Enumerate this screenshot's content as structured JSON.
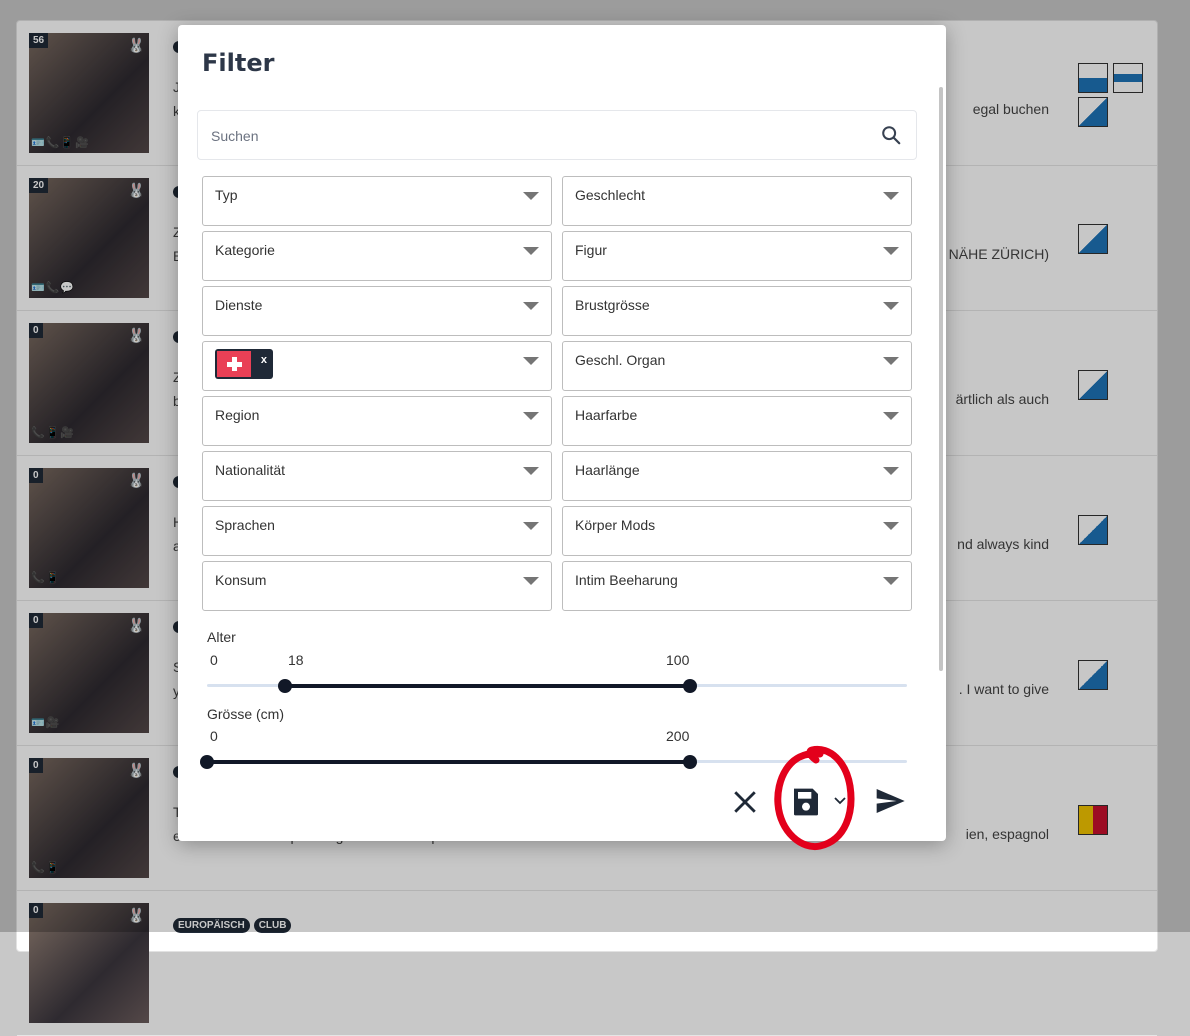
{
  "background": {
    "rows": [
      {
        "count": "56",
        "line1": "J",
        "line2": "k",
        "right1": "egal buchen",
        "bunny_color": "#e94056",
        "icons": "🪪📞📱🎥"
      },
      {
        "count": "20",
        "line1": "Z",
        "line2": "B",
        "right1": "NÄHE ZÜRICH)",
        "bunny_color": "#f2c500",
        "icons": "🪪📞💬"
      },
      {
        "count": "0",
        "line1": "Z",
        "line2": "b",
        "right1": "ärtlich als auch",
        "bunny_color": "#e5e5e5",
        "icons": "📞📱🎥"
      },
      {
        "count": "0",
        "line1": "H",
        "line2": "a",
        "right1": "nd always kind",
        "bunny_color": "#e5e5e5",
        "icons": "📞📱"
      },
      {
        "count": "0",
        "line1": "S",
        "line2": "y",
        "right1": ". I want to give",
        "bunny_color": "#e5e5e5",
        "icons": "🪪🎥"
      },
      {
        "count": "0",
        "line1": "T",
        "line2": "et Allemand. Se déplace également. Mes photos sont bien rée...",
        "right1": "ien, espagnol",
        "bunny_color": "#e5e5e5",
        "icons": "📞📱"
      },
      {
        "count": "0",
        "line1": "",
        "line2": "",
        "right1": "",
        "bunny_color": "#e5e5e5",
        "icons": ""
      }
    ],
    "tags": [
      "EUROPÄISCH",
      "CLUB"
    ]
  },
  "modal": {
    "title": "Filter",
    "search": {
      "placeholder": "Suchen"
    },
    "left_filters": [
      "Typ",
      "Kategorie",
      "Dienste",
      "",
      "Region",
      "Nationalität",
      "Sprachen",
      "Konsum"
    ],
    "right_filters": [
      "Geschlecht",
      "Figur",
      "Brustgrösse",
      "Geschl. Organ",
      "Haarfarbe",
      "Haarlänge",
      "Körper Mods",
      "Intim Beeharung"
    ],
    "country_chip": {
      "country": "Switzerland",
      "remove_label": "x"
    },
    "age": {
      "label": "Alter",
      "min": "0",
      "low": "18",
      "high": "100",
      "low_value": 18,
      "high_value": 100,
      "max_value": 145
    },
    "size": {
      "label": "Grösse (cm)",
      "min": "0",
      "high": "200",
      "low_value": 0,
      "high_value": 200,
      "max_value": 290
    }
  },
  "colors": {
    "accent": "#111827",
    "highlight": "#e3001b"
  }
}
